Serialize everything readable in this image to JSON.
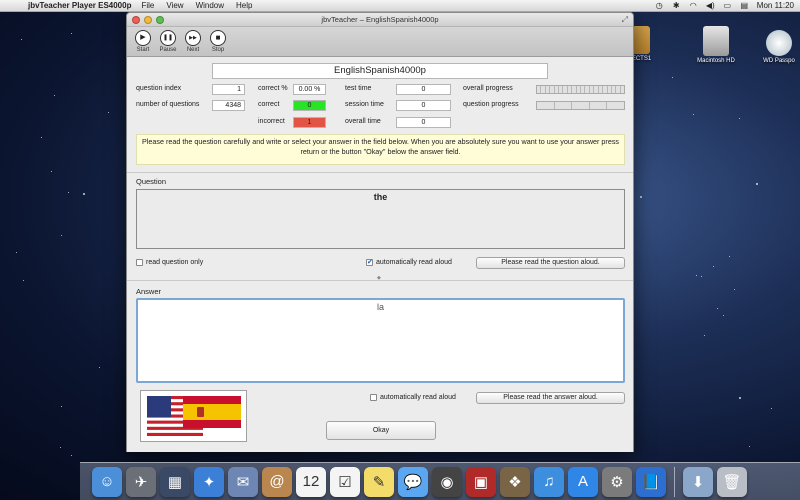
{
  "menubar": {
    "app_name": "jbvTeacher Player ES4000p",
    "menus": [
      "File",
      "View",
      "Window",
      "Help"
    ],
    "clock": "Mon 11:20"
  },
  "desktop": {
    "icons": [
      {
        "name": "usb-drive-icon",
        "label": "JECTS1"
      },
      {
        "name": "macintosh-hd-icon",
        "label": "Macintosh HD"
      },
      {
        "name": "wd-passport-icon",
        "label": "WD Passpo"
      }
    ]
  },
  "window": {
    "title": "jbvTeacher – EnglishSpanish4000p",
    "toolbar": [
      {
        "label": "Start",
        "icon": "play-icon",
        "glyph": "▶"
      },
      {
        "label": "Pause",
        "icon": "pause-icon",
        "glyph": "❚❚"
      },
      {
        "label": "Next",
        "icon": "next-icon",
        "glyph": "▶▶"
      },
      {
        "label": "Stop",
        "icon": "stop-icon",
        "glyph": "■"
      }
    ],
    "lesson_title": "EnglishSpanish4000p",
    "stats": {
      "question_index_label": "question index",
      "question_index": "1",
      "number_of_questions_label": "number of questions",
      "number_of_questions": "4348",
      "correct_percent_label": "correct %",
      "correct_percent": "0.00 %",
      "correct_label": "correct",
      "correct": "0",
      "incorrect_label": "incorrect",
      "incorrect": "1",
      "test_time_label": "test time",
      "test_time": "0",
      "session_time_label": "session time",
      "session_time": "0",
      "overall_time_label": "overall time",
      "overall_time": "0",
      "overall_progress_label": "overall progress",
      "question_progress_label": "question progress",
      "overall_progress": 0,
      "question_progress": 0
    },
    "instructions": "Please read the question carefully and write or select your answer in the field below. When you are absolutely sure you want to use your answer press return or the button \"Okay\" below the answer field.",
    "question": {
      "section_label": "Question",
      "text": "the",
      "read_only_label": "read question only",
      "read_only_checked": false,
      "auto_read_label": "automatically read aloud",
      "auto_read_checked": true,
      "read_button": "Please read the question aloud."
    },
    "answer": {
      "section_label": "Answer",
      "text": "la",
      "auto_read_label": "automatically read aloud",
      "auto_read_checked": false,
      "read_button": "Please read the answer aloud.",
      "okay_button": "Okay"
    },
    "colors": {
      "correct": "#27e427",
      "incorrect": "#e05545",
      "instructions_bg": "#fffcd8",
      "answer_focus": "#7aa6d8"
    }
  },
  "dock": {
    "items": [
      {
        "name": "finder-icon",
        "color": "#4a8fd8",
        "glyph": "☺"
      },
      {
        "name": "launchpad-icon",
        "color": "#6b6f78",
        "glyph": "✈"
      },
      {
        "name": "mission-control-icon",
        "color": "#3a4a66",
        "glyph": "▦"
      },
      {
        "name": "safari-icon",
        "color": "#3b7fd6",
        "glyph": "✦"
      },
      {
        "name": "mail-icon",
        "color": "#6d86b3",
        "glyph": "✉"
      },
      {
        "name": "contacts-icon",
        "color": "#b8864e",
        "glyph": "@"
      },
      {
        "name": "calendar-icon",
        "color": "#f4f4f4",
        "glyph": "12"
      },
      {
        "name": "reminders-icon",
        "color": "#f4f4f4",
        "glyph": "☑"
      },
      {
        "name": "notes-icon",
        "color": "#f4dc6a",
        "glyph": "✎"
      },
      {
        "name": "messages-icon",
        "color": "#5aa6f0",
        "glyph": "💬"
      },
      {
        "name": "facetime-icon",
        "color": "#444",
        "glyph": "◉"
      },
      {
        "name": "photo-booth-icon",
        "color": "#b02a2a",
        "glyph": "▣"
      },
      {
        "name": "iphoto-icon",
        "color": "#7a6446",
        "glyph": "❖"
      },
      {
        "name": "itunes-icon",
        "color": "#3e8ee0",
        "glyph": "♫"
      },
      {
        "name": "app-store-icon",
        "color": "#2f86e6",
        "glyph": "A"
      },
      {
        "name": "system-preferences-icon",
        "color": "#7b7b7b",
        "glyph": "⚙"
      },
      {
        "name": "jbvteacher-icon",
        "color": "#2c6fd1",
        "glyph": "📘"
      }
    ],
    "right_items": [
      {
        "name": "downloads-stack-icon",
        "color": "#8aa6c8",
        "glyph": "⬇"
      },
      {
        "name": "trash-icon",
        "color": "#b9bec6",
        "glyph": "🗑"
      }
    ]
  }
}
